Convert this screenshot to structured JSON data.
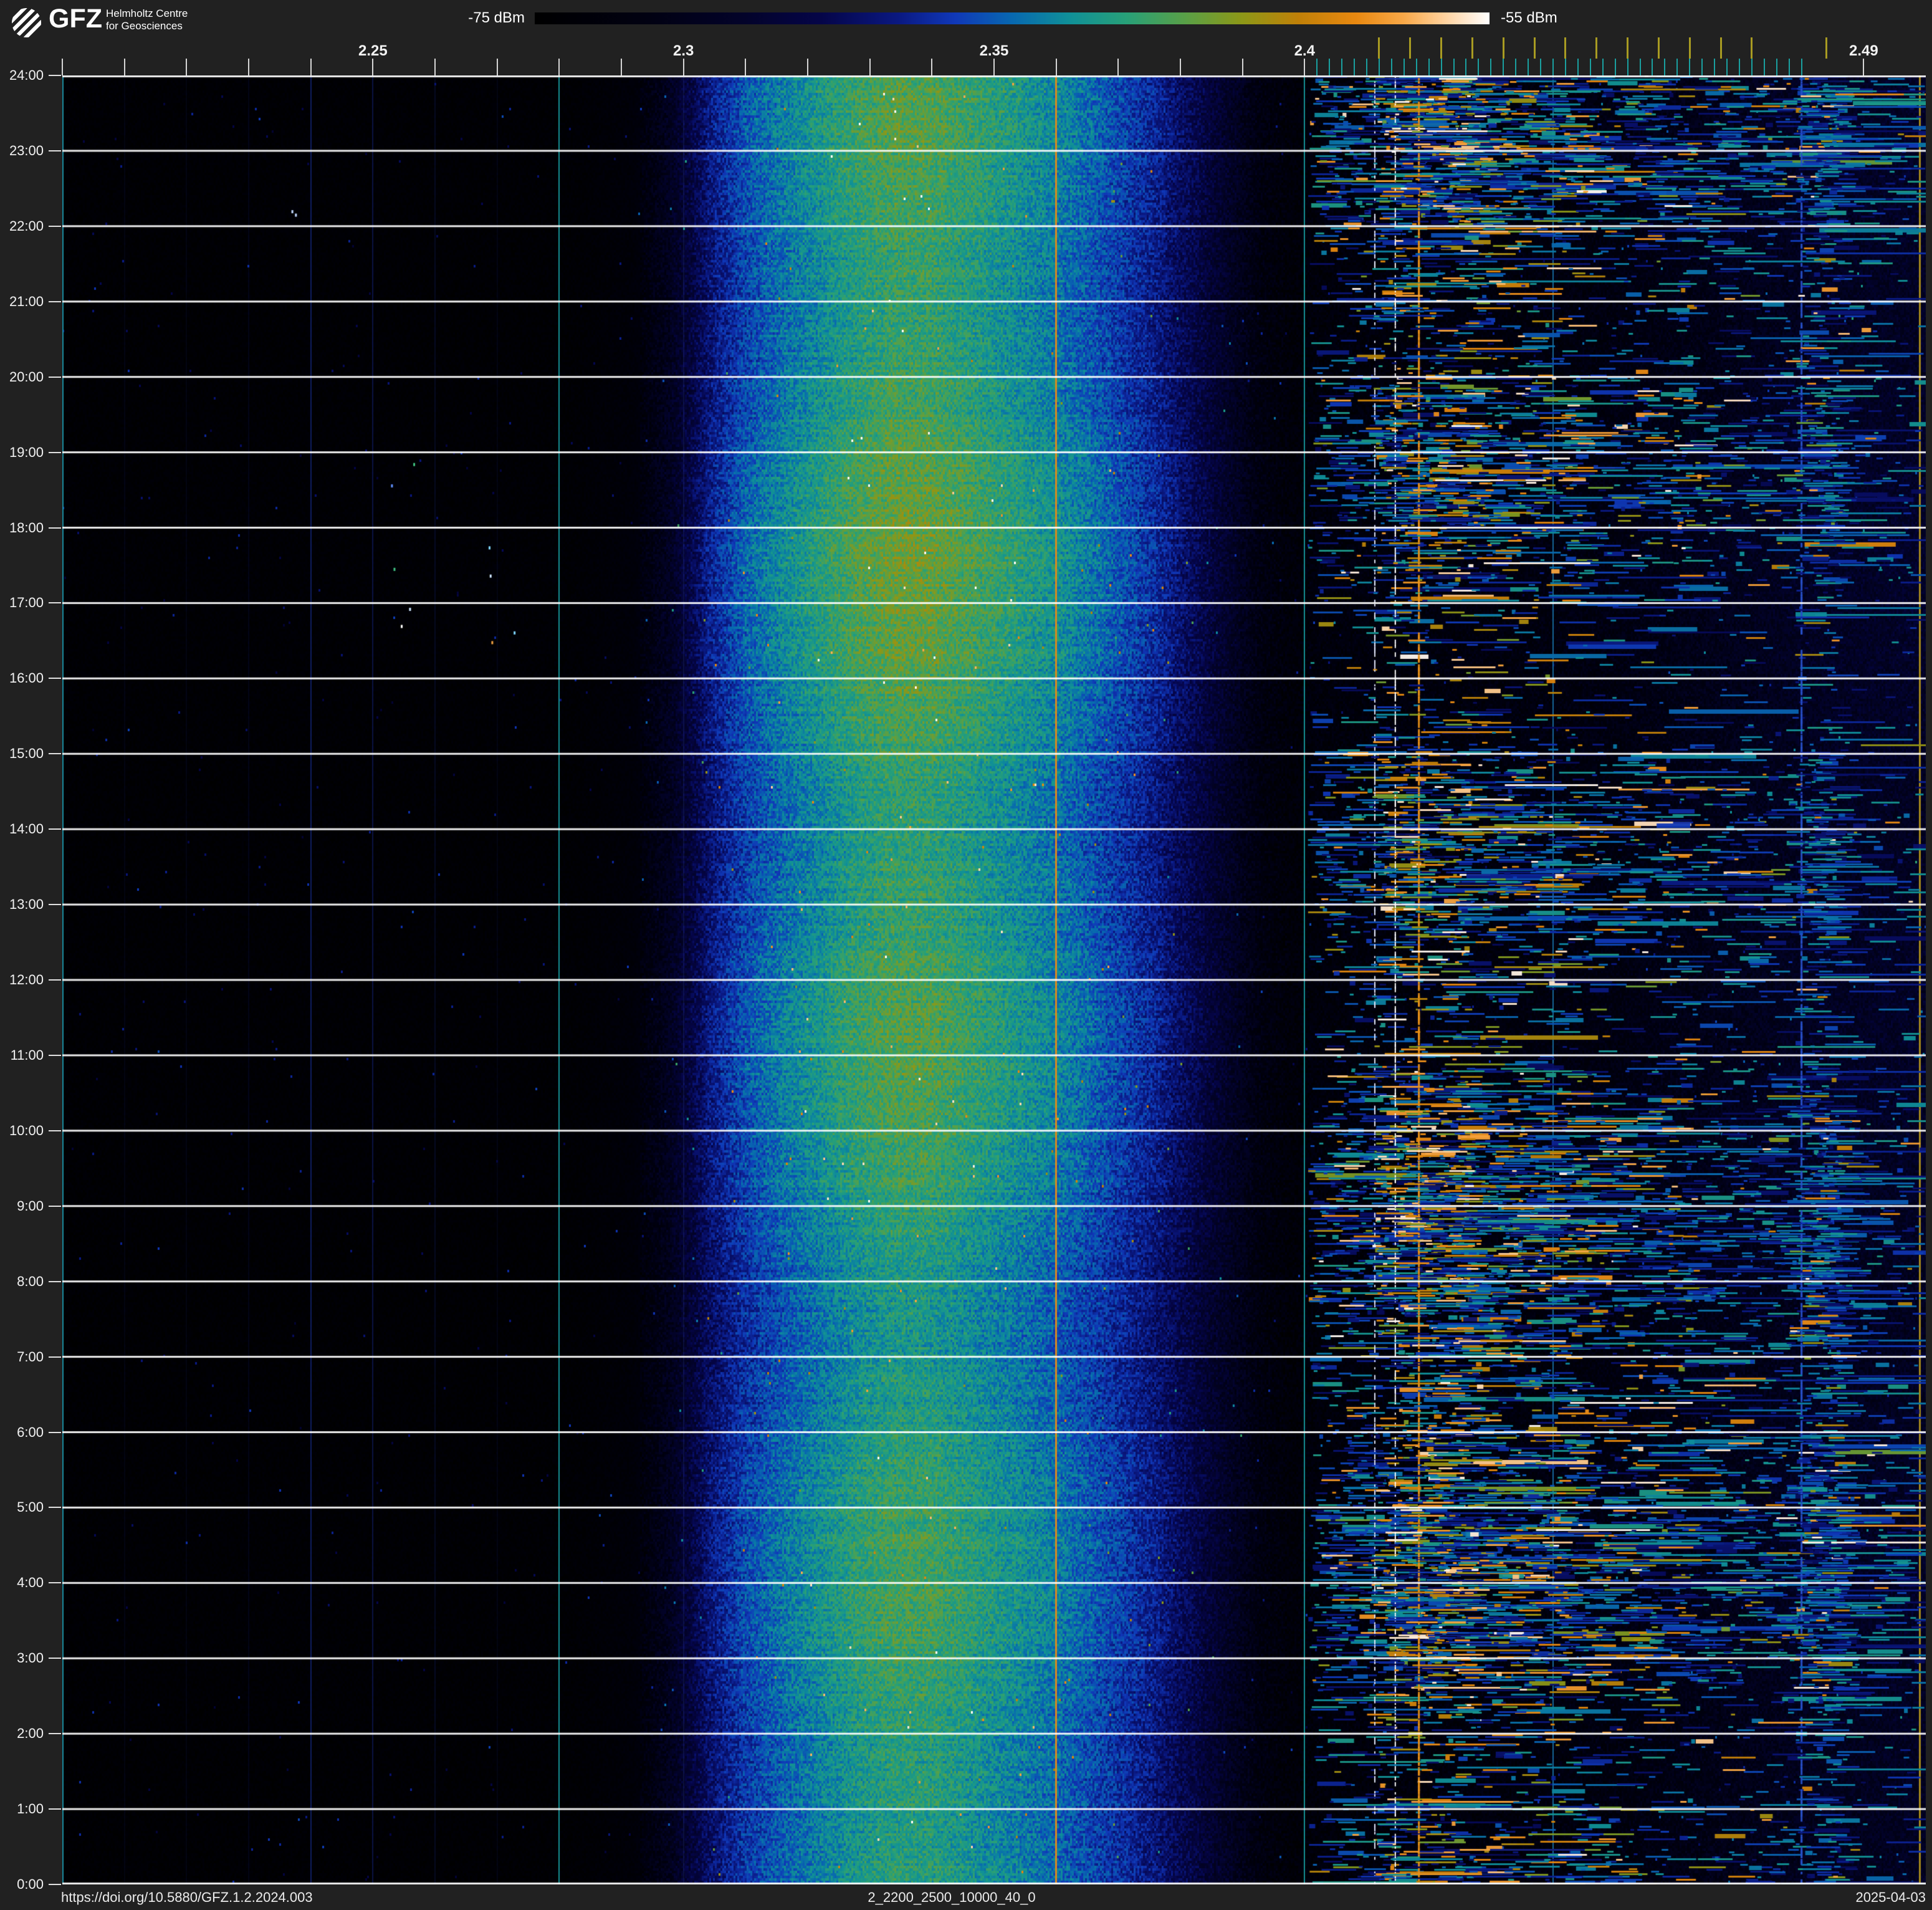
{
  "header": {
    "logo_text": "GFZ",
    "org_line1": "Helmholtz Centre",
    "org_line2": "for Geosciences"
  },
  "colorbar": {
    "min_label": "-75 dBm",
    "max_label": "-55 dBm",
    "stops": [
      [
        0.0,
        "#000000"
      ],
      [
        0.12,
        "#010112"
      ],
      [
        0.22,
        "#03032a"
      ],
      [
        0.3,
        "#050548"
      ],
      [
        0.38,
        "#0a1880"
      ],
      [
        0.44,
        "#1038b8"
      ],
      [
        0.5,
        "#0868b0"
      ],
      [
        0.56,
        "#109098"
      ],
      [
        0.62,
        "#28a078"
      ],
      [
        0.68,
        "#58a048"
      ],
      [
        0.74,
        "#8c9818"
      ],
      [
        0.8,
        "#c08008"
      ],
      [
        0.86,
        "#e88810"
      ],
      [
        0.91,
        "#f8a848"
      ],
      [
        0.95,
        "#ffcf98"
      ],
      [
        1.0,
        "#ffffff"
      ]
    ]
  },
  "footer": {
    "doi": "https://doi.org/10.5880/GFZ.1.2.2024.003",
    "filename": "2_2200_2500_10000_40_0",
    "date": "2025-04-03"
  },
  "chart_data": {
    "type": "heatmap",
    "title": "",
    "intensity_scale": {
      "min_dbm": -75,
      "max_dbm": -55,
      "unit": "dBm"
    },
    "x_axis": {
      "unit": "GHz",
      "min": 2.2,
      "max": 2.5,
      "labels": [
        {
          "text": "2.25",
          "value": 2.25
        },
        {
          "text": "2.3",
          "value": 2.3
        },
        {
          "text": "2.35",
          "value": 2.35
        },
        {
          "text": "2.4",
          "value": 2.4
        },
        {
          "text": "2.49",
          "value": 2.49
        }
      ],
      "minor_tick_start": 2.2,
      "minor_tick_end": 2.4,
      "minor_tick_step": 0.01,
      "extra_white_ticks": [
        2.49
      ],
      "ble_channel_ticks": {
        "start": 2.402,
        "end": 2.48,
        "step": 0.002,
        "color": "#1aa0a0"
      },
      "wifi_channel_ticks": {
        "values": [
          2.412,
          2.417,
          2.422,
          2.427,
          2.432,
          2.437,
          2.442,
          2.447,
          2.452,
          2.457,
          2.462,
          2.467,
          2.472,
          2.484
        ],
        "color": "#a89b22"
      }
    },
    "y_axis": {
      "labels": [
        "24:00",
        "23:00",
        "22:00",
        "21:00",
        "20:00",
        "19:00",
        "18:00",
        "17:00",
        "16:00",
        "15:00",
        "14:00",
        "13:00",
        "12:00",
        "11:00",
        "10:00",
        "9:00",
        "8:00",
        "7:00",
        "6:00",
        "5:00",
        "4:00",
        "3:00",
        "2:00",
        "1:00",
        "0:00"
      ],
      "hours_top_to_bottom": [
        24,
        0
      ]
    },
    "gridlines": {
      "horizontal_every_hours": 1,
      "color": "#ffffff"
    },
    "features": {
      "band_profile": [
        [
          2.2,
          0.03
        ],
        [
          2.282,
          0.032
        ],
        [
          2.292,
          0.06
        ],
        [
          2.298,
          0.18
        ],
        [
          2.304,
          0.36
        ],
        [
          2.31,
          0.46
        ],
        [
          2.316,
          0.52
        ],
        [
          2.322,
          0.57
        ],
        [
          2.328,
          0.62
        ],
        [
          2.334,
          0.65
        ],
        [
          2.34,
          0.645
        ],
        [
          2.346,
          0.615
        ],
        [
          2.352,
          0.58
        ],
        [
          2.358,
          0.545
        ],
        [
          2.364,
          0.5
        ],
        [
          2.37,
          0.445
        ],
        [
          2.376,
          0.385
        ],
        [
          2.382,
          0.3
        ],
        [
          2.388,
          0.2
        ],
        [
          2.393,
          0.1
        ],
        [
          2.398,
          0.065
        ],
        [
          2.402,
          0.075
        ],
        [
          2.43,
          0.085
        ],
        [
          2.45,
          0.105
        ],
        [
          2.462,
          0.135
        ],
        [
          2.472,
          0.16
        ],
        [
          2.482,
          0.18
        ],
        [
          2.5,
          0.2
        ]
      ],
      "noise_amp": {
        "quiet": 0.05,
        "band": 0.13,
        "ism": 0.11
      },
      "vlines": [
        {
          "f": 2.2,
          "color": "#1b8fa4",
          "alpha": 0.95,
          "w": 2
        },
        {
          "f": 2.21,
          "color": "#2030c0",
          "alpha": 0.08,
          "w": 2
        },
        {
          "f": 2.22,
          "color": "#2030c0",
          "alpha": 0.08,
          "w": 2
        },
        {
          "f": 2.23,
          "color": "#2030c0",
          "alpha": 0.1,
          "w": 2
        },
        {
          "f": 2.24,
          "color": "#2040d0",
          "alpha": 0.45,
          "w": 2
        },
        {
          "f": 2.25,
          "color": "#2040d0",
          "alpha": 0.3,
          "w": 2
        },
        {
          "f": 2.26,
          "color": "#2040d0",
          "alpha": 0.15,
          "w": 2
        },
        {
          "f": 2.27,
          "color": "#2040d0",
          "alpha": 0.08,
          "w": 2
        },
        {
          "f": 2.28,
          "color": "#17989c",
          "alpha": 0.95,
          "w": 2
        },
        {
          "f": 2.3,
          "color": "#4868e8",
          "alpha": 0.14,
          "w": 2
        },
        {
          "f": 2.36,
          "color": "#e08a1a",
          "alpha": 0.95,
          "w": 3
        },
        {
          "f": 2.4,
          "color": "#17989c",
          "alpha": 0.95,
          "w": 2
        },
        {
          "f": 2.44,
          "color": "#1a78b0",
          "alpha": 0.85,
          "w": 2
        },
        {
          "f": 2.499,
          "color": "#ad8f1c",
          "alpha": 0.95,
          "w": 3
        }
      ],
      "ism_subbands": [
        {
          "f0": 2.4005,
          "f1": 2.411,
          "density": 2.2,
          "hot": 0.08,
          "white": 0.015
        },
        {
          "f0": 2.411,
          "f1": 2.4265,
          "density": 6.5,
          "hot": 0.28,
          "white": 0.05
        },
        {
          "f0": 2.4265,
          "f1": 2.444,
          "density": 4.2,
          "hot": 0.2,
          "white": 0.03
        },
        {
          "f0": 2.444,
          "f1": 2.462,
          "density": 2.8,
          "hot": 0.13,
          "white": 0.02
        },
        {
          "f0": 2.462,
          "f1": 2.479,
          "density": 2.2,
          "hot": 0.08,
          "white": 0.012
        },
        {
          "f0": 2.479,
          "f1": 2.486,
          "density": 2.8,
          "hot": 0.06,
          "white": 0.01
        },
        {
          "f0": 2.486,
          "f1": 2.499,
          "density": 0.9,
          "hot": 0.04,
          "white": 0.008
        }
      ],
      "ism_columns": [
        {
          "f": 2.4113,
          "w": 2,
          "color": "#e8ecff",
          "prob": 0.4,
          "hmin": 3,
          "hmax": 9
        },
        {
          "f": 2.4146,
          "w": 2,
          "color": "#ffffff",
          "prob": 0.5,
          "hmin": 3,
          "hmax": 10
        },
        {
          "f": 2.4184,
          "w": 3,
          "color": "#e89018",
          "prob": 0.72,
          "hmin": 4,
          "hmax": 13
        },
        {
          "f": 2.48,
          "w": 3,
          "color": "#2850c8",
          "prob": 0.55,
          "hmin": 4,
          "hmax": 12
        }
      ],
      "specks": [
        {
          "f0": 2.248,
          "f1": 2.274,
          "t0": 16.4,
          "t1": 17.9,
          "count": 7,
          "colors": [
            "#ffffff",
            "#80d8ff",
            "#f0a040",
            "#40c080",
            "#d0e8ff"
          ]
        },
        {
          "f0": 2.23,
          "f1": 2.24,
          "t0": 21.9,
          "t1": 22.3,
          "count": 2,
          "colors": [
            "#6090ff",
            "#c0d8ff"
          ]
        },
        {
          "f0": 2.252,
          "f1": 2.262,
          "t0": 18.3,
          "t1": 18.9,
          "count": 2,
          "colors": [
            "#40c080",
            "#6090ff"
          ]
        }
      ]
    }
  }
}
